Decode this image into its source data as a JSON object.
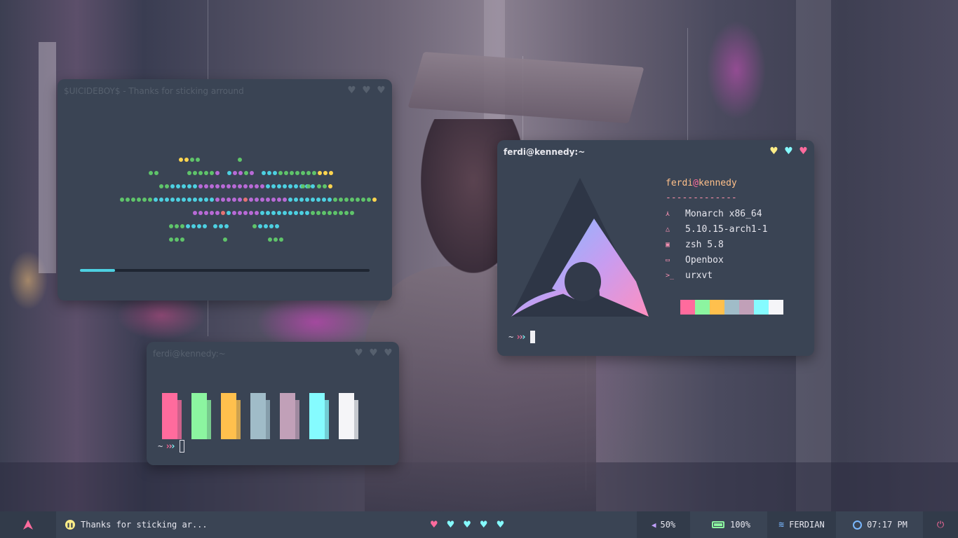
{
  "theme": {
    "pink": "#ff6b9d",
    "green": "#8cf5a0",
    "yellow": "#ffc04d",
    "grey": "#a0bcc8",
    "mauve": "#c1a0b8",
    "cyan": "#85fbff",
    "white": "#f5f5f8",
    "window_bg": "#3a4454"
  },
  "visualizer_window": {
    "title": "$UICIDEBOY$ - Thanks for sticking arround",
    "progress_fraction": 0.12
  },
  "colors_window": {
    "title": "ferdi@kennedy:~",
    "prompt_tilde": "~",
    "blocks": [
      "pink",
      "green",
      "yellow",
      "grey",
      "mauve",
      "cyan",
      "white"
    ]
  },
  "fetch_window": {
    "title": "ferdi@kennedy:~",
    "user": "ferdi",
    "at": "@",
    "host": "kennedy",
    "separator": "-------------",
    "info": [
      {
        "icon": "arch-icon",
        "glyph": "⋏",
        "value": "Monarch x86_64"
      },
      {
        "icon": "kernel-icon",
        "glyph": "△",
        "value": "5.10.15-arch1-1"
      },
      {
        "icon": "shell-icon",
        "glyph": "▣",
        "value": "zsh 5.8"
      },
      {
        "icon": "wm-icon",
        "glyph": "▭",
        "value": "Openbox"
      },
      {
        "icon": "terminal-icon",
        "glyph": ">_",
        "value": "urxvt"
      }
    ],
    "prompt_tilde": "~",
    "swatches": [
      "#3a4454",
      "#ff6b9d",
      "#8cf5a0",
      "#ffc04d",
      "#a0bcc8",
      "#c1a0b8",
      "#85fbff",
      "#f5f5f8"
    ]
  },
  "taskbar": {
    "now_playing": "Thanks for sticking ar...",
    "volume": "50%",
    "battery": "100%",
    "wifi": "FERDIAN",
    "time": "07:17 PM"
  }
}
